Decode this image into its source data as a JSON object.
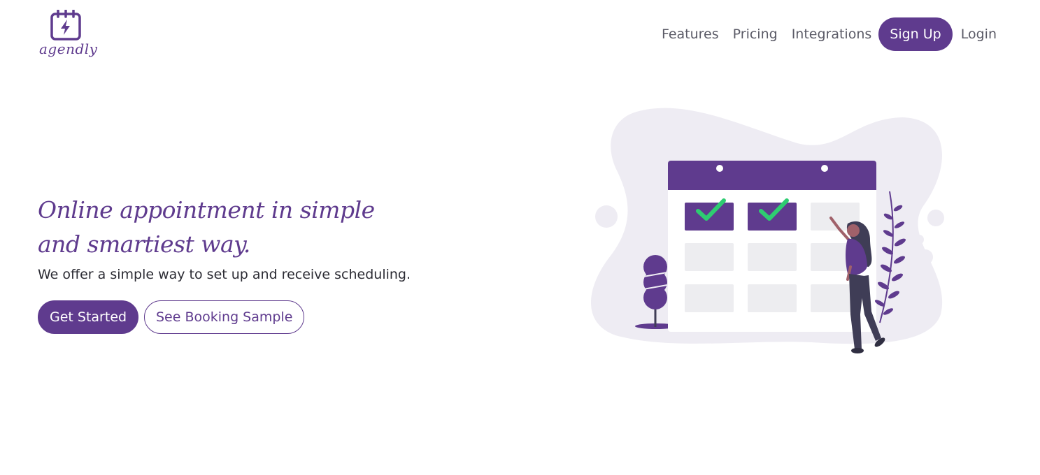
{
  "brand": {
    "logo_text": "agendly",
    "logo_icon": "calendar-lightning-icon",
    "accent_color": "#5f3b8e"
  },
  "nav": {
    "items": [
      {
        "label": "Features"
      },
      {
        "label": "Pricing"
      },
      {
        "label": "Integrations"
      }
    ],
    "signup_label": "Sign Up",
    "login_label": "Login"
  },
  "hero": {
    "title_line1": "Online appointment in simple",
    "title_line2": "and smartiest way.",
    "subtitle": "We offer a simple way to set up and receive scheduling.",
    "primary_cta": "Get Started",
    "secondary_cta": "See Booking Sample"
  },
  "illustration": {
    "name": "woman-checking-calendar-illustration",
    "checkmark_color": "#2ecc71"
  }
}
